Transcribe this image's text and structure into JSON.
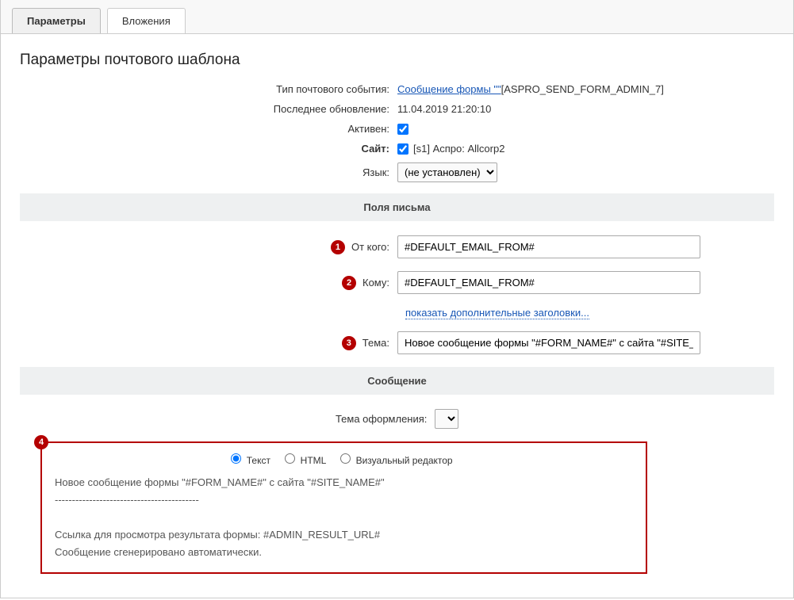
{
  "tabs": {
    "params": "Параметры",
    "attachments": "Вложения"
  },
  "heading": "Параметры почтового шаблона",
  "badges": {
    "b1": "1",
    "b2": "2",
    "b3": "3",
    "b4": "4"
  },
  "rows": {
    "event_type_label": "Тип почтового события:",
    "event_type_link": "Сообщение формы \"\"",
    "event_type_code": " [ASPRO_SEND_FORM_ADMIN_7]",
    "last_update_label": "Последнее обновление:",
    "last_update_value": "11.04.2019 21:20:10",
    "active_label": "Активен:",
    "site_label": "Сайт:",
    "site_value": "[s1] Аспро: Allcorp2",
    "lang_label": "Язык:",
    "lang_value": "(не установлен)"
  },
  "sections": {
    "letter_fields": "Поля письма",
    "message": "Сообщение"
  },
  "fields": {
    "from_label": "От кого:",
    "from_value": "#DEFAULT_EMAIL_FROM#",
    "to_label": "Кому:",
    "to_value": "#DEFAULT_EMAIL_FROM#",
    "more_headers": "показать дополнительные заголовки...",
    "subject_label": "Тема:",
    "subject_value": "Новое сообщение формы \"#FORM_NAME#\" с сайта \"#SITE_NAME#\""
  },
  "theme": {
    "label": "Тема оформления:",
    "selected": ""
  },
  "format": {
    "text": "Текст",
    "html": "HTML",
    "visual": "Визуальный редактор"
  },
  "message_body": "Новое сообщение формы \"#FORM_NAME#\" с сайта \"#SITE_NAME#\"\n------------------------------------------\n\nСсылка для просмотра результата формы: #ADMIN_RESULT_URL#\nСообщение сгенерировано автоматически."
}
